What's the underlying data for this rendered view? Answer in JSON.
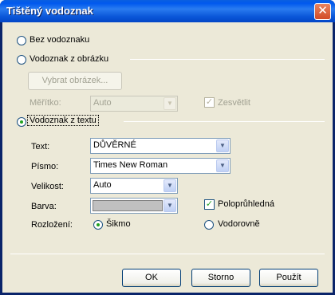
{
  "window": {
    "title": "Tištěný vodoznak",
    "close_glyph": "✕"
  },
  "options": {
    "none_label": "Bez vodoznaku",
    "picture_label": "Vodoznak z obrázku",
    "text_label": "Vodoznak z textu"
  },
  "picture": {
    "select_button": "Vybrat obrázek...",
    "scale_label": "Měřítko:",
    "scale_value": "Auto",
    "washout_label": "Zesvětlit",
    "washout_checked": true
  },
  "text": {
    "text_label": "Text:",
    "text_value": "DŮVĚRNÉ",
    "font_label": "Písmo:",
    "font_value": "Times New Roman",
    "size_label": "Velikost:",
    "size_value": "Auto",
    "color_label": "Barva:",
    "color_value": "#c0c0c0",
    "semitransparent_label": "Poloprůhledná",
    "semitransparent_checked": true,
    "layout_label": "Rozložení:",
    "diagonal_label": "Šikmo",
    "horizontal_label": "Vodorovně"
  },
  "buttons": {
    "ok": "OK",
    "cancel": "Storno",
    "apply": "Použít"
  },
  "colors": {
    "title_bar": "#0058ee",
    "dialog_bg": "#ece9d8",
    "radio_dot": "#21a121"
  }
}
